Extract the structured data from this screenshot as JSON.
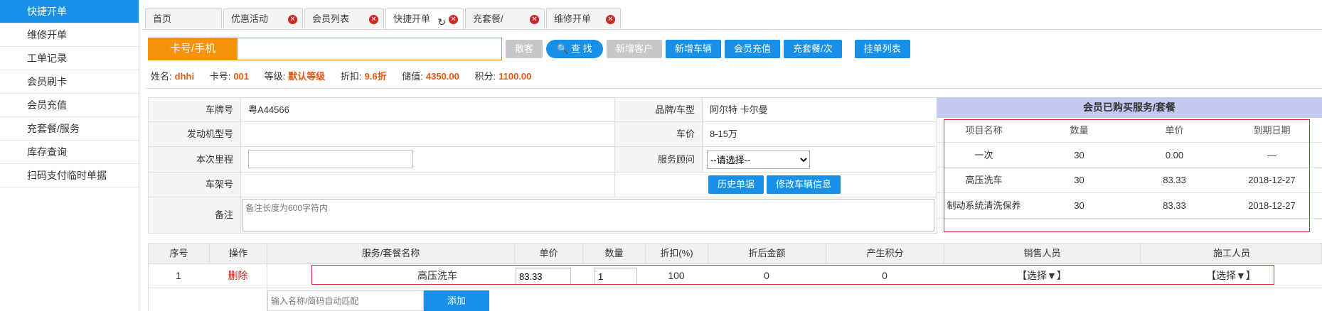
{
  "sidebar": {
    "items": [
      {
        "label": "快捷开单"
      },
      {
        "label": "维修开单"
      },
      {
        "label": "工单记录"
      },
      {
        "label": "会员刷卡"
      },
      {
        "label": "会员充值"
      },
      {
        "label": "充套餐/服务"
      },
      {
        "label": "库存查询"
      },
      {
        "label": "扫码支付临时单据"
      }
    ]
  },
  "tabs": [
    {
      "label": "首页"
    },
    {
      "label": "优惠活动"
    },
    {
      "label": "会员列表"
    },
    {
      "label": "快捷开单"
    },
    {
      "label": "充套餐/"
    },
    {
      "label": "维修开单"
    }
  ],
  "search": {
    "label": "卡号/手机",
    "value": "",
    "buttons": {
      "walkin": "散客",
      "find": "查 找",
      "new_customer": "新增客户",
      "new_vehicle": "新增车辆",
      "member_recharge": "会员充值",
      "recharge_package": "充套餐/次",
      "pending_list": "挂单列表"
    }
  },
  "member": {
    "name_label": "姓名:",
    "name": "dhhi",
    "card_label": "卡号:",
    "card": "001",
    "level_label": "等级:",
    "level": "默认等级",
    "discount_label": "折扣:",
    "discount": "9.6折",
    "balance_label": "储值:",
    "balance": "4350.00",
    "points_label": "积分:",
    "points": "1100.00"
  },
  "vehicle": {
    "plate_label": "车牌号",
    "plate": "粤A44566",
    "engine_label": "发动机型号",
    "engine": "",
    "mileage_label": "本次里程",
    "mileage": "",
    "vin_label": "车架号",
    "vin": "",
    "remark_label": "备注",
    "remark_placeholder": "备注长度为600字符内",
    "brand_label": "品牌/车型",
    "brand": "阿尔特 卡尔曼",
    "price_label": "车价",
    "price": "8-15万",
    "advisor_label": "服务顾问",
    "advisor": "--请选择--",
    "history_button": "历史单据",
    "edit_button": "修改车辆信息"
  },
  "packages": {
    "title": "会员已购买服务/套餐",
    "columns": [
      "项目名称",
      "数量",
      "单价",
      "到期日期"
    ],
    "rows": [
      [
        "一次",
        "30",
        "0.00",
        "—"
      ],
      [
        "高压洗车",
        "30",
        "83.33",
        "2018-12-27"
      ],
      [
        "制动系统清洗保养",
        "30",
        "83.33",
        "2018-12-27"
      ]
    ]
  },
  "services": {
    "columns": [
      "序号",
      "操作",
      "服务/套餐名称",
      "单价",
      "数量",
      "折扣(%)",
      "折后金额",
      "产生积分",
      "销售人员",
      "施工人员"
    ],
    "rows": [
      {
        "no": "1",
        "action": "删除",
        "name": "高压洗车",
        "price": "83.33",
        "qty": "1",
        "discount": "100",
        "amount": "0",
        "points": "0",
        "sales": "【选择▼】",
        "worker": "【选择▼】"
      }
    ],
    "add_placeholder": "输入名称/简码自动匹配",
    "add_button": "添加"
  },
  "colors": {
    "accent": "#1890e8",
    "orange": "#f7930a",
    "value": "#e8570e",
    "close": "#d32424",
    "highlight": "#d9292a"
  }
}
